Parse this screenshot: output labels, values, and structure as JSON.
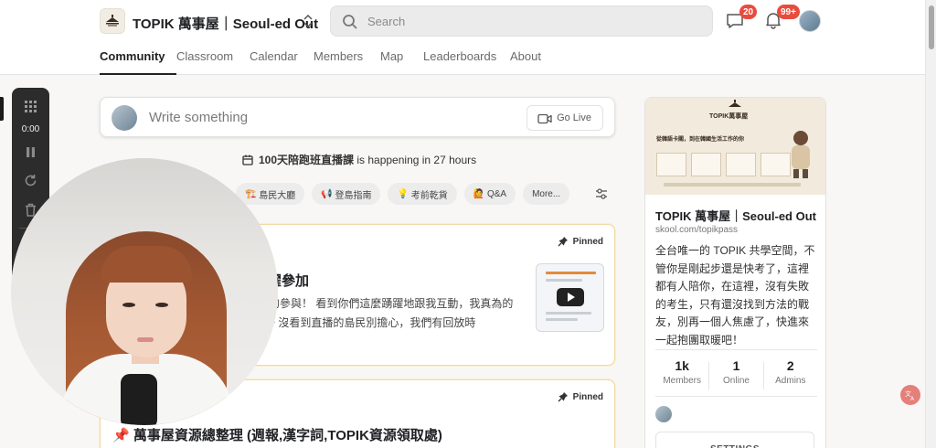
{
  "header": {
    "group_title": "TOPIK 萬事屋｜Seoul-ed Out",
    "search_placeholder": "Search",
    "chat_badge": "20",
    "notification_badge": "99+"
  },
  "nav": {
    "tabs": [
      {
        "label": "Community",
        "active": true
      },
      {
        "label": "Classroom",
        "active": false
      },
      {
        "label": "Calendar",
        "active": false
      },
      {
        "label": "Members",
        "active": false
      },
      {
        "label": "Map",
        "active": false
      },
      {
        "label": "Leaderboards",
        "active": false
      },
      {
        "label": "About",
        "active": false
      }
    ]
  },
  "composer": {
    "placeholder": "Write something",
    "go_live": "Go Live"
  },
  "event": {
    "name": "100天陪跑班直播課",
    "suffix": " is happening in 27 hours"
  },
  "categories": [
    {
      "icon": "🏗️",
      "label": "島民大廳"
    },
    {
      "icon": "📢",
      "label": "登島指南"
    },
    {
      "icon": "💡",
      "label": "考前乾貨"
    },
    {
      "icon": "🙋",
      "label": "Q&A"
    },
    {
      "icon": "",
      "label": "More..."
    }
  ],
  "posts": [
    {
      "pinned_label": "Pinned",
      "title": "躍參加",
      "body": "今天的參與！ 看到你們這麼踴躍地跟我互動，我真為的收穫~ 沒看到直播的島民別擔心，我們有回放時"
    },
    {
      "pinned_label": "Pinned",
      "title": "📌 萬事屋資源總整理 (週報,漢字詞,TOPIK資源領取處)"
    }
  ],
  "about_panel": {
    "banner": {
      "title": "TOPIK萬事屋",
      "tagline": "從韓語卡關，到在韓國生活工作的你"
    },
    "title": "TOPIK 萬事屋｜Seoul-ed Out",
    "url": "skool.com/topikpass",
    "description": "全台唯一的 TOPIK 共學空間，不管你是剛起步還是快考了，這裡都有人陪你，在這裡，沒有失敗的考生，只有還沒找到方法的戰友，別再一個人焦慮了，快進來一起抱團取暖吧！",
    "stats": [
      {
        "value": "1k",
        "label": "Members"
      },
      {
        "value": "1",
        "label": "Online"
      },
      {
        "value": "2",
        "label": "Admins"
      }
    ],
    "settings_label": "SETTINGS"
  },
  "recorder": {
    "time": "0:00"
  },
  "colors": {
    "badge": "#e84c3d",
    "pinned_border": "#f1d9a3",
    "recorder_bg": "#2c2c2c"
  }
}
